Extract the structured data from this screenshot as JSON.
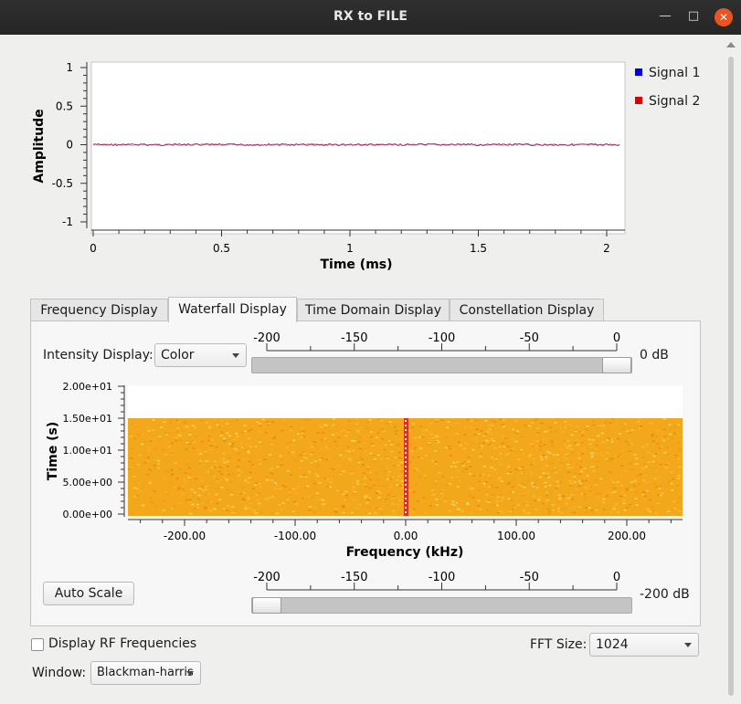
{
  "window": {
    "title": "RX to FILE"
  },
  "time_plot": {
    "ylabel": "Amplitude",
    "xlabel": "Time (ms)",
    "y_ticks": [
      "1",
      "0.5",
      "0",
      "-0.5",
      "-1"
    ],
    "x_ticks": [
      "0",
      "0.5",
      "1",
      "1.5",
      "2"
    ],
    "legend": [
      {
        "name": "Signal 1",
        "color": "#0000ee"
      },
      {
        "name": "Signal 2",
        "color": "#e00000"
      }
    ]
  },
  "tabs": [
    "Frequency Display",
    "Waterfall Display",
    "Time Domain Display",
    "Constellation Display"
  ],
  "active_tab": 1,
  "waterfall": {
    "intensity_label": "Intensity Display:",
    "intensity_mode": "Color",
    "top_slider": {
      "ticks": [
        "-200",
        "-150",
        "-100",
        "-50",
        "0"
      ],
      "value_label": "0 dB",
      "level": 1.0
    },
    "ylabel": "Time (s)",
    "xlabel": "Frequency (kHz)",
    "y_ticks": [
      "2.00e+01",
      "1.50e+01",
      "1.00e+01",
      "5.00e+00",
      "0.00e+00"
    ],
    "x_ticks": [
      "-200.00",
      "-100.00",
      "0.00",
      "100.00",
      "200.00"
    ],
    "auto_scale_label": "Auto Scale",
    "bottom_slider": {
      "ticks": [
        "-200",
        "-150",
        "-100",
        "-50",
        "0"
      ],
      "value_label": "-200 dB",
      "level": 0.0
    }
  },
  "footer": {
    "rf_checkbox_label": "Display RF Frequencies",
    "rf_checked": false,
    "fft_label": "FFT Size:",
    "fft_value": "1024",
    "window_label": "Window:",
    "window_value": "Blackman-harris"
  }
}
